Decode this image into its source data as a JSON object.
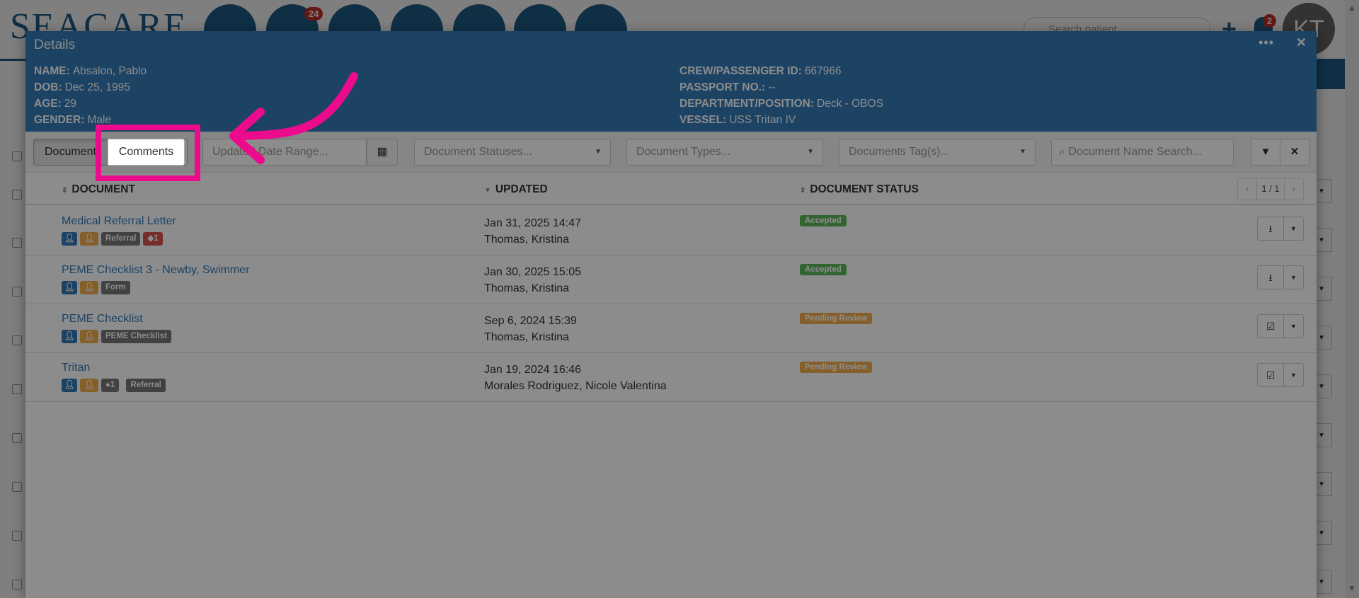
{
  "background_app": {
    "logo": "SEACARE",
    "notification_count_1": "24",
    "notification_count_2": "2",
    "search_placeholder": "Search patient",
    "avatar_initials": "KT"
  },
  "modal": {
    "title": "Details",
    "patient": {
      "name_label": "NAME:",
      "name": "Absalon, Pablo",
      "dob_label": "DOB:",
      "dob": "Dec 25, 1995",
      "age_label": "AGE:",
      "age": "29",
      "gender_label": "GENDER:",
      "gender": "Male",
      "crew_id_label": "CREW/PASSENGER ID:",
      "crew_id": "667966",
      "passport_label": "PASSPORT NO.:",
      "passport": "--",
      "department_label": "DEPARTMENT/POSITION:",
      "department": "Deck - OBOS",
      "vessel_label": "VESSEL:",
      "vessel": "USS Tritan IV"
    },
    "toolbar": {
      "documents_label": "Documents",
      "comments_label": "Comments",
      "date_range_placeholder": "Updated Date Range...",
      "statuses_placeholder": "Document Statuses...",
      "types_placeholder": "Document Types...",
      "tags_placeholder": "Documents Tag(s)...",
      "name_search_placeholder": "Document Name Search..."
    },
    "table": {
      "columns": [
        "DOCUMENT",
        "UPDATED",
        "DOCUMENT STATUS"
      ],
      "pager": "1 / 1",
      "rows": [
        {
          "name": "Medical Referral Letter",
          "tags": [
            "Referral"
          ],
          "tag_count": "1",
          "updated_date": "Jan 31, 2025 14:47",
          "updated_by": "Thomas, Kristina",
          "status": "Accepted"
        },
        {
          "name": "PEME Checklist 3 - Newby, Swimmer",
          "tags": [
            "Form"
          ],
          "updated_date": "Jan 30, 2025 15:05",
          "updated_by": "Thomas, Kristina",
          "status": "Accepted"
        },
        {
          "name": "PEME Checklist",
          "tags": [
            "PEME Checklist"
          ],
          "updated_date": "Sep 6, 2024 15:39",
          "updated_by": "Thomas, Kristina",
          "status": "Pending Review"
        },
        {
          "name": "Tritan",
          "tags": [
            "Referral"
          ],
          "comment_count": "1",
          "updated_date": "Jan 19, 2024 16:46",
          "updated_by": "Morales Rodriguez, Nicole Valentina",
          "status": "Pending Review"
        }
      ]
    }
  },
  "colors": {
    "header_blue": "#337ab7",
    "success": "#5cb85c",
    "warning": "#f0ad4e",
    "highlight": "#ec0b8d"
  }
}
